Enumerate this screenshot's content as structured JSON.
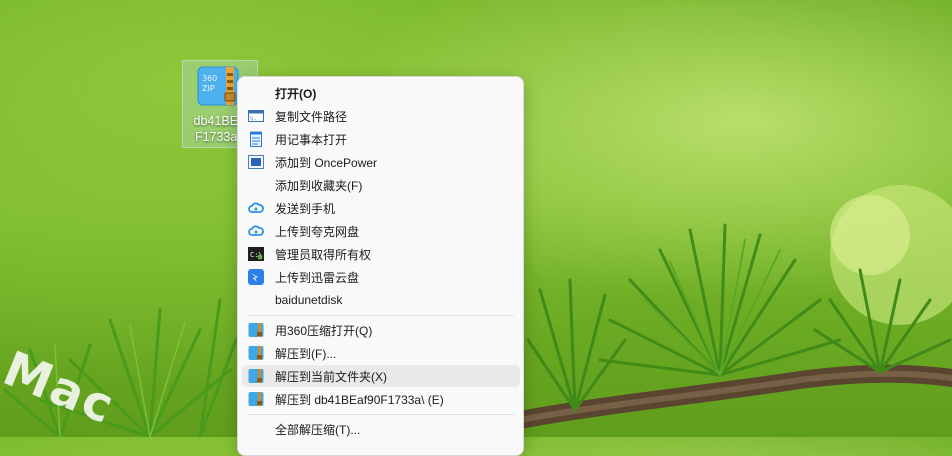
{
  "desktop": {
    "icon": {
      "filename_line1": "db41BEaf",
      "filename_line2": "F1733a.z"
    },
    "watermark": "Mac"
  },
  "context_menu": {
    "items": [
      {
        "label": "打开(O)",
        "icon": "none",
        "bold": true
      },
      {
        "label": "复制文件路径",
        "icon": "path-copy-icon"
      },
      {
        "label": "用记事本打开",
        "icon": "notepad-icon"
      },
      {
        "label": "添加到 OncePower",
        "icon": "oncepower-icon"
      },
      {
        "label": "添加到收藏夹(F)",
        "icon": "none"
      },
      {
        "label": "发送到手机",
        "icon": "cloud-icon"
      },
      {
        "label": "上传到夸克网盘",
        "icon": "cloud-icon"
      },
      {
        "label": "管理员取得所有权",
        "icon": "console-icon"
      },
      {
        "label": "上传到迅雷云盘",
        "icon": "thunder-icon"
      },
      {
        "label": "baidunetdisk",
        "icon": "none"
      },
      {
        "label": "用360压缩打开(Q)",
        "icon": "zip-icon"
      },
      {
        "label": "解压到(F)...",
        "icon": "zip-icon"
      },
      {
        "label": "解压到当前文件夹(X)",
        "icon": "zip-icon",
        "highlighted": true
      },
      {
        "label": "解压到 db41BEaf90F1733a\\ (E)",
        "icon": "zip-icon"
      },
      {
        "label": "全部解压缩(T)...",
        "icon": "none"
      }
    ]
  },
  "colors": {
    "menu_bg": "#f9f9f9",
    "highlight": "#e9e9e9",
    "zip_blue": "#3fa6e8",
    "zip_band": "#d98a1c"
  }
}
